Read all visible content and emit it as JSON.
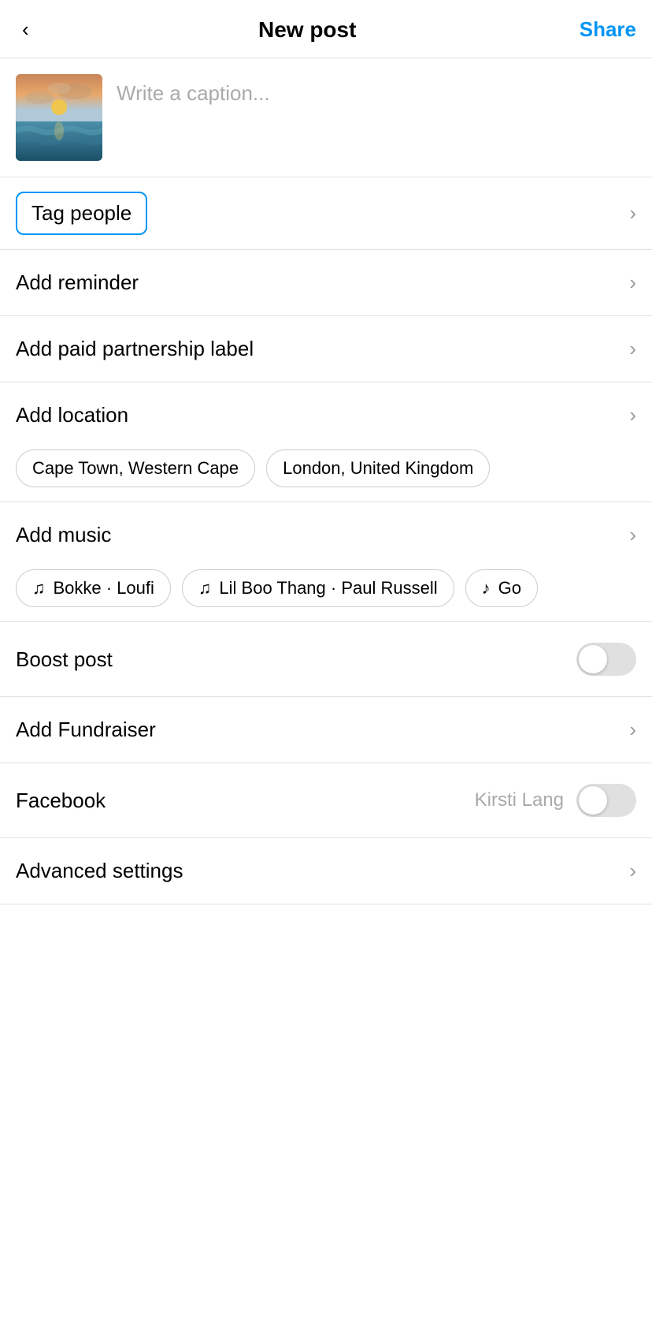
{
  "header": {
    "back_label": "‹",
    "title": "New post",
    "share_label": "Share"
  },
  "caption": {
    "placeholder": "Write a caption..."
  },
  "menu_items": [
    {
      "id": "tag-people",
      "label": "Tag people",
      "has_chevron": true,
      "highlighted": true
    },
    {
      "id": "add-reminder",
      "label": "Add reminder",
      "has_chevron": true
    },
    {
      "id": "add-paid-partnership",
      "label": "Add paid partnership label",
      "has_chevron": true
    },
    {
      "id": "add-location",
      "label": "Add location",
      "has_chevron": true
    }
  ],
  "location_chips": [
    {
      "id": "cape-town",
      "label": "Cape Town, Western Cape"
    },
    {
      "id": "london",
      "label": "London, United Kingdom"
    }
  ],
  "music_section": {
    "label": "Add music",
    "has_chevron": true,
    "chips": [
      {
        "id": "bokke-loufi",
        "note": "♫",
        "label": "Bokke · Loufi"
      },
      {
        "id": "lil-boo-thang",
        "note": "♫",
        "label": "Lil Boo Thang · Paul Russell"
      },
      {
        "id": "other",
        "note": "♩",
        "label": "Go"
      }
    ]
  },
  "boost_post": {
    "label": "Boost post",
    "enabled": false
  },
  "add_fundraiser": {
    "label": "Add Fundraiser",
    "has_chevron": true
  },
  "facebook": {
    "label": "Facebook",
    "user": "Kirsti Lang",
    "enabled": false
  },
  "advanced_settings": {
    "label": "Advanced settings",
    "has_chevron": true
  }
}
